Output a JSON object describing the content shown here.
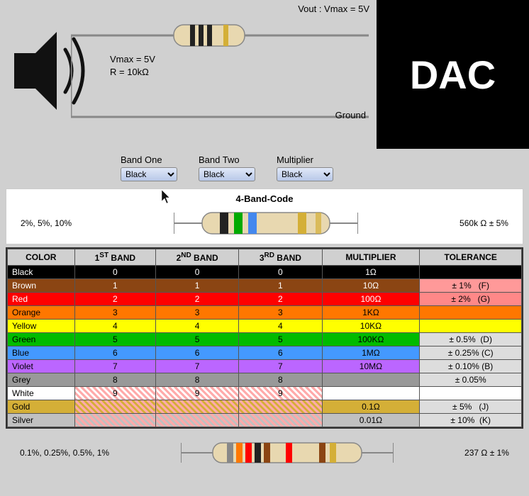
{
  "dac": {
    "label": "DAC"
  },
  "circuit": {
    "vout": "V",
    "vout_label": "Vout : Vmax = 5V",
    "vmax": "Vmax = 5V",
    "r_val": "R = 10kΩ",
    "ground": "Ground"
  },
  "band_selectors": {
    "band_one_label": "Band One",
    "band_two_label": "Band Two",
    "multiplier_label": "Multiplier",
    "band_one_value": "Black",
    "band_two_value": "Black",
    "multiplier_value": "Black"
  },
  "resistor_diagram": {
    "title": "4-Band-Code",
    "left_label": "2%, 5%, 10%",
    "right_label": "560k Ω  ± 5%"
  },
  "table": {
    "headers": [
      "COLOR",
      "1ST BAND",
      "2ND BAND",
      "3RD BAND",
      "MULTIPLIER",
      "TOLERANCE"
    ],
    "rows": [
      {
        "name": "Black",
        "b1": "0",
        "b2": "0",
        "b3": "0",
        "mult": "1Ω",
        "tol": ""
      },
      {
        "name": "Brown",
        "b1": "1",
        "b2": "1",
        "b3": "1",
        "mult": "10Ω",
        "tol": "± 1%   (F)"
      },
      {
        "name": "Red",
        "b1": "2",
        "b2": "2",
        "b3": "2",
        "mult": "100Ω",
        "tol": "± 2%   (G)"
      },
      {
        "name": "Orange",
        "b1": "3",
        "b2": "3",
        "b3": "3",
        "mult": "1KΩ",
        "tol": ""
      },
      {
        "name": "Yellow",
        "b1": "4",
        "b2": "4",
        "b3": "4",
        "mult": "10KΩ",
        "tol": ""
      },
      {
        "name": "Green",
        "b1": "5",
        "b2": "5",
        "b3": "5",
        "mult": "100KΩ",
        "tol": "± 0.5%  (D)"
      },
      {
        "name": "Blue",
        "b1": "6",
        "b2": "6",
        "b3": "6",
        "mult": "1MΩ",
        "tol": "± 0.25% (C)"
      },
      {
        "name": "Violet",
        "b1": "7",
        "b2": "7",
        "b3": "7",
        "mult": "10MΩ",
        "tol": "± 0.10% (B)"
      },
      {
        "name": "Grey",
        "b1": "8",
        "b2": "8",
        "b3": "8",
        "mult": "",
        "tol": "± 0.05%"
      },
      {
        "name": "White",
        "b1": "9",
        "b2": "9",
        "b3": "9",
        "mult": "",
        "tol": ""
      },
      {
        "name": "Gold",
        "b1": "",
        "b2": "",
        "b3": "",
        "mult": "0.1Ω",
        "tol": "± 5%   (J)"
      },
      {
        "name": "Silver",
        "b1": "",
        "b2": "",
        "b3": "",
        "mult": "0.01Ω",
        "tol": "± 10%  (K)"
      }
    ]
  },
  "bottom": {
    "left_label": "0.1%, 0.25%, 0.5%, 1%",
    "right_label": "237 Ω  ± 1%"
  }
}
